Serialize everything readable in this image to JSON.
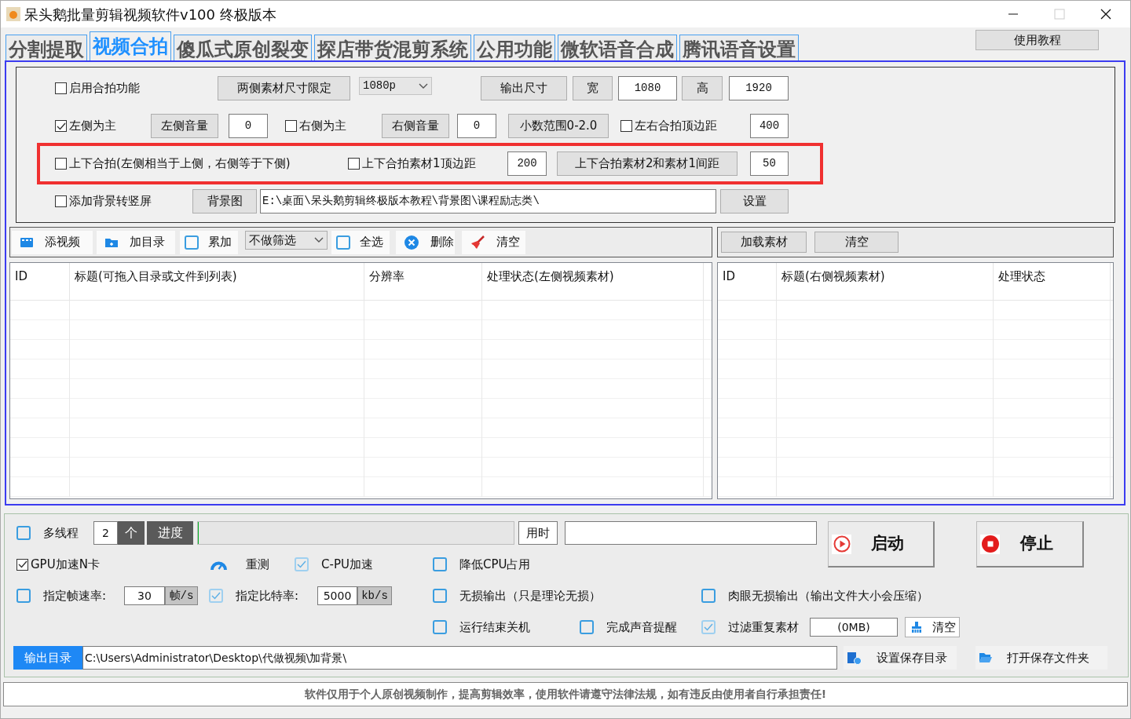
{
  "window": {
    "title": "呆头鹅批量剪辑视频软件v100 终极版本"
  },
  "tabs": [
    {
      "label": "分割提取",
      "selected": false
    },
    {
      "label": "视频合拍",
      "selected": true
    },
    {
      "label": "傻瓜式原创裂变",
      "selected": false
    },
    {
      "label": "探店带货混剪系统",
      "selected": false
    },
    {
      "label": "公用功能",
      "selected": false
    },
    {
      "label": "微软语音合成",
      "selected": false
    },
    {
      "label": "腾讯语音设置",
      "selected": false
    }
  ],
  "help_button": "使用教程",
  "settings": {
    "rows": [
      {
        "highlighted": false,
        "items": [
          {
            "kind": "checkbox",
            "label": "启用合拍功能",
            "checked": false
          },
          {
            "kind": "button",
            "label": "两侧素材尺寸限定"
          },
          {
            "kind": "select",
            "value": "1080p"
          },
          {
            "kind": "button",
            "label": "输出尺寸"
          },
          {
            "kind": "button",
            "label": "宽"
          },
          {
            "kind": "field",
            "value": "1080"
          },
          {
            "kind": "button",
            "label": "高"
          },
          {
            "kind": "field",
            "value": "1920"
          }
        ]
      },
      {
        "highlighted": false,
        "items": [
          {
            "kind": "checkbox",
            "label": "左侧为主",
            "checked": true
          },
          {
            "kind": "button",
            "label": "左侧音量"
          },
          {
            "kind": "field",
            "value": "0"
          },
          {
            "kind": "checkbox",
            "label": "右侧为主",
            "checked": false
          },
          {
            "kind": "button",
            "label": "右侧音量"
          },
          {
            "kind": "field",
            "value": "0"
          },
          {
            "kind": "button",
            "label": "小数范围0-2.0"
          },
          {
            "kind": "checkbox",
            "label": "左右合拍顶边距",
            "checked": false
          },
          {
            "kind": "field",
            "value": "400"
          }
        ]
      },
      {
        "highlighted": true,
        "items": [
          {
            "kind": "checkbox",
            "label": "上下合拍(左侧相当于上侧，右侧等于下侧)",
            "checked": false
          },
          {
            "kind": "checkbox",
            "label": "上下合拍素材1顶边距",
            "checked": false
          },
          {
            "kind": "field",
            "value": "200"
          },
          {
            "kind": "button",
            "label": "上下合拍素材2和素材1间距"
          },
          {
            "kind": "field",
            "value": "50"
          }
        ]
      },
      {
        "highlighted": false,
        "items": [
          {
            "kind": "checkbox",
            "label": "添加背景转竖屏",
            "checked": false
          },
          {
            "kind": "button",
            "label": "背景图"
          },
          {
            "kind": "field",
            "value": "E:\\桌面\\呆头鹅剪辑终极版本教程\\背景图\\课程励志类\\"
          },
          {
            "kind": "button",
            "label": "设置"
          }
        ]
      }
    ]
  },
  "left_toolbar": [
    {
      "kind": "add-video",
      "label": "添视频"
    },
    {
      "kind": "add-folder",
      "label": "加目录"
    },
    {
      "kind": "checkbox",
      "label": "累加",
      "checked": false
    },
    {
      "kind": "select",
      "value": "不做筛选"
    },
    {
      "kind": "checkbox",
      "label": "全选",
      "checked": false
    },
    {
      "kind": "delete",
      "label": "删除"
    },
    {
      "kind": "broom",
      "label": "清空"
    }
  ],
  "right_toolbar": [
    {
      "label": "加载素材"
    },
    {
      "label": "清空"
    }
  ],
  "left_table": {
    "columns": [
      "ID",
      "标题(可拖入目录或文件到列表)",
      "分辨率",
      "处理状态(左侧视频素材)"
    ]
  },
  "right_table": {
    "columns": [
      "ID",
      "标题(右侧视频素材)",
      "处理状态"
    ]
  },
  "bottom_panel": {
    "lines": [
      {
        "controls": [
          {
            "kind": "flat-checkbox",
            "label": "多线程",
            "checked": false
          },
          {
            "kind": "field",
            "value": "2"
          },
          {
            "kind": "dark-label",
            "text": "个"
          },
          {
            "kind": "dark-label",
            "text": "进度"
          },
          {
            "kind": "progress",
            "level": 0
          },
          {
            "kind": "caption",
            "text": "用时"
          },
          {
            "kind": "field"
          },
          {
            "kind": "play-button",
            "label": "启动"
          },
          {
            "kind": "stop-button",
            "label": "停止"
          }
        ]
      },
      {
        "controls": [
          {
            "kind": "checkbox",
            "label": "GPU加速N卡",
            "checked": true
          },
          {
            "kind": "gauge-button",
            "label": "重测"
          },
          {
            "kind": "flat-checkbox",
            "label": "C-PU加速",
            "checked": true
          },
          {
            "kind": "flat-checkbox",
            "label": "降低CPU占用",
            "checked": false
          }
        ]
      },
      {
        "controls": [
          {
            "kind": "flat-checkbox",
            "label": "指定帧速率:",
            "checked": false
          },
          {
            "kind": "field",
            "value": "30"
          },
          {
            "kind": "unit",
            "text": "帧/s"
          },
          {
            "kind": "flat-checkbox",
            "label": "指定比特率:",
            "checked": true
          },
          {
            "kind": "field",
            "value": "5000"
          },
          {
            "kind": "unit",
            "text": "kb/s"
          },
          {
            "kind": "flat-checkbox",
            "label": "无损输出（只是理论无损）",
            "checked": false
          },
          {
            "kind": "flat-checkbox",
            "label": "肉眼无损输出（输出文件大小会压缩）",
            "checked": false
          }
        ]
      },
      {
        "controls": [
          {
            "kind": "flat-checkbox",
            "label": "运行结束关机",
            "checked": false
          },
          {
            "kind": "flat-checkbox",
            "label": "完成声音提醒",
            "checked": false
          },
          {
            "kind": "flat-checkbox",
            "label": "过滤重复素材",
            "checked": true
          },
          {
            "kind": "field",
            "value": "(0MB)"
          },
          {
            "kind": "broom-button",
            "label": "清空"
          }
        ]
      },
      {
        "controls": [
          {
            "kind": "blue-label",
            "text": "输出目录"
          },
          {
            "kind": "field",
            "value": "C:\\Users\\Administrator\\Desktop\\代做视频\\加背景\\"
          },
          {
            "kind": "set-folder-button",
            "label": "设置保存目录"
          },
          {
            "kind": "open-folder-button",
            "label": "打开保存文件夹"
          }
        ]
      }
    ]
  },
  "footer": "软件仅用于个人原创视频制作，提高剪辑效率，使用软件请遵守法律法规，如有违反由使用者自行承担责任!"
}
